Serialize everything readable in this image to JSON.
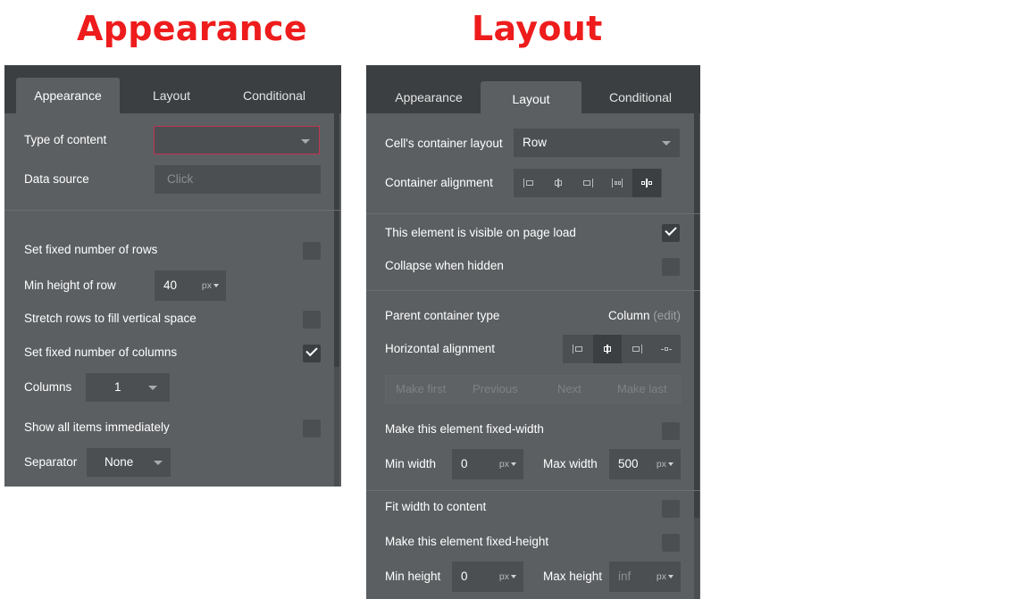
{
  "titles": {
    "appearance": "Appearance",
    "layout": "Layout"
  },
  "panel_appearance": {
    "tabs": [
      "Appearance",
      "Layout",
      "Conditional"
    ],
    "type_of_content": {
      "label": "Type of content",
      "value": ""
    },
    "data_source": {
      "label": "Data source",
      "placeholder": "Click"
    },
    "fixed_rows": {
      "label": "Set fixed number of rows",
      "checked": false
    },
    "min_height_row": {
      "label": "Min height of row",
      "value": "40",
      "unit": "px"
    },
    "stretch_rows": {
      "label": "Stretch rows to fill vertical space",
      "checked": false
    },
    "fixed_columns": {
      "label": "Set fixed number of columns",
      "checked": true
    },
    "columns": {
      "label": "Columns",
      "value": "1"
    },
    "show_all": {
      "label": "Show all items immediately",
      "checked": false
    },
    "separator": {
      "label": "Separator",
      "value": "None"
    }
  },
  "panel_layout": {
    "tabs": [
      "Appearance",
      "Layout",
      "Conditional"
    ],
    "cell_container_layout": {
      "label": "Cell's container layout",
      "value": "Row"
    },
    "container_alignment": {
      "label": "Container alignment",
      "active": "space-around"
    },
    "visible_on_load": {
      "label": "This element is visible on page load",
      "checked": true
    },
    "collapse_hidden": {
      "label": "Collapse when hidden",
      "checked": false
    },
    "parent_container": {
      "label": "Parent container type",
      "value": "Column",
      "edit": "(edit)"
    },
    "horizontal_alignment": {
      "label": "Horizontal alignment",
      "active": "center"
    },
    "order_nav": {
      "make_first": "Make first",
      "previous": "Previous",
      "next": "Next",
      "make_last": "Make last"
    },
    "fixed_width": {
      "label": "Make this element fixed-width",
      "checked": false
    },
    "min_width": {
      "label": "Min width",
      "value": "0",
      "unit": "px"
    },
    "max_width": {
      "label": "Max width",
      "value": "500",
      "unit": "px"
    },
    "fit_width": {
      "label": "Fit width to content",
      "checked": false
    },
    "fixed_height": {
      "label": "Make this element fixed-height",
      "checked": false
    },
    "min_height": {
      "label": "Min height",
      "value": "0",
      "unit": "px"
    },
    "max_height": {
      "label": "Max height",
      "placeholder": "inf",
      "unit": "px"
    }
  },
  "colors": {
    "title_red": "#ee1c1c",
    "panel_bg": "#5b5f62",
    "tabbar_bg": "#3b3f42",
    "field_bg": "#4b4f52",
    "invalid_border": "#c0334f"
  }
}
